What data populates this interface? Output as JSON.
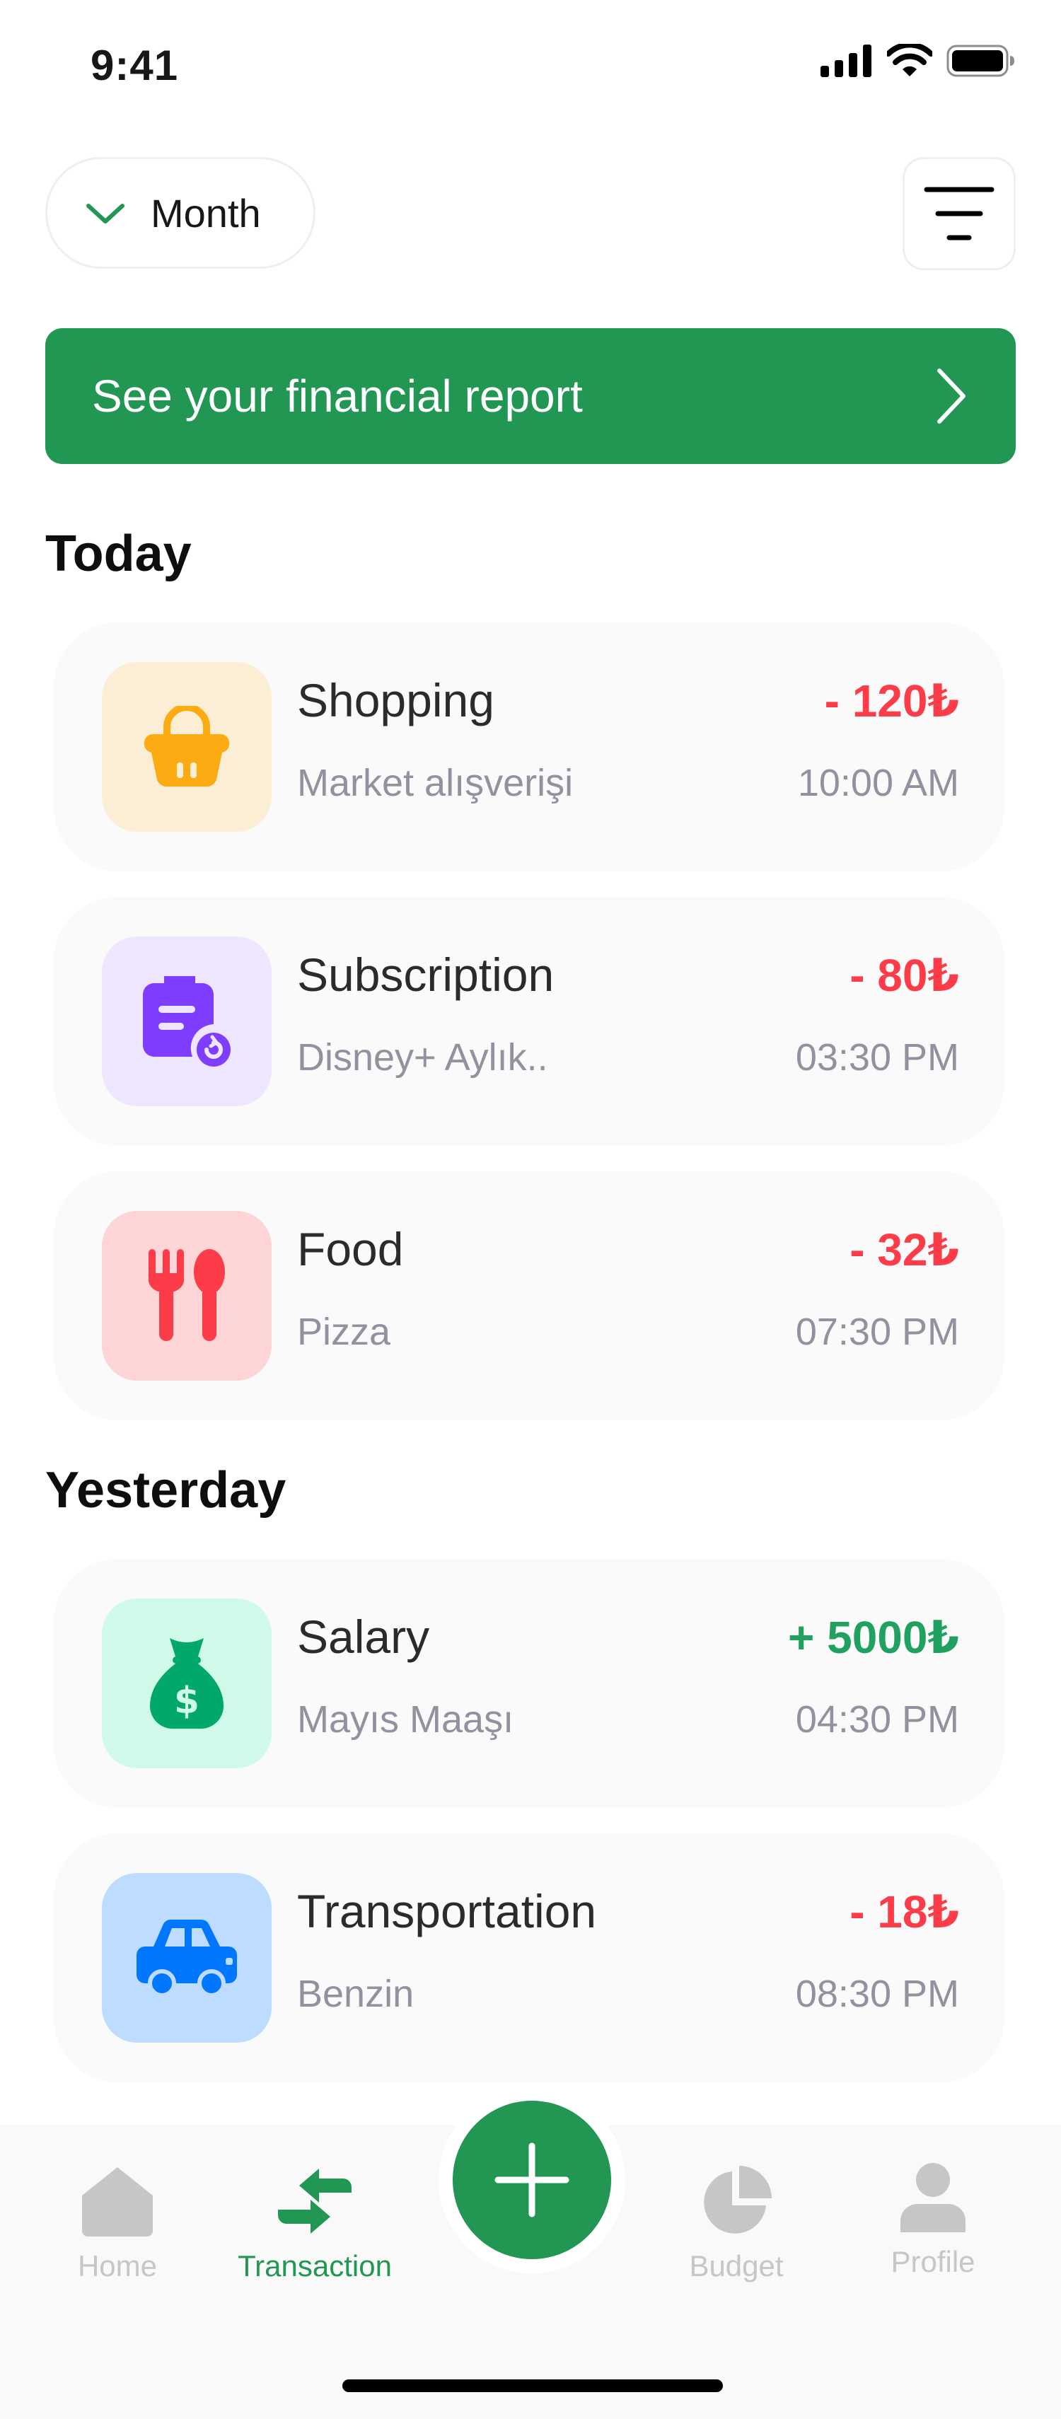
{
  "status_bar": {
    "time": "9:41",
    "icons": [
      "cellular-signal-icon",
      "wifi-icon",
      "battery-icon"
    ]
  },
  "header": {
    "period_selector": {
      "label": "Month",
      "icon": "chevron-down-icon"
    },
    "filter_button": {
      "icon": "filter-icon"
    }
  },
  "report_banner": {
    "label": "See your financial report",
    "icon": "chevron-right-icon"
  },
  "sections": [
    {
      "title": "Today",
      "transactions": [
        {
          "category": "Shopping",
          "note": "Market alışverişi",
          "amount": "- 120₺",
          "time": "10:00 AM",
          "icon": "shopping-basket-icon",
          "type": "expense"
        },
        {
          "category": "Subscription",
          "note": "Disney+ Aylık..",
          "amount": "- 80₺",
          "time": "03:30 PM",
          "icon": "subscription-icon",
          "type": "expense"
        },
        {
          "category": "Food",
          "note": "Pizza",
          "amount": "- 32₺",
          "time": "07:30 PM",
          "icon": "restaurant-icon",
          "type": "expense"
        }
      ]
    },
    {
      "title": "Yesterday",
      "transactions": [
        {
          "category": "Salary",
          "note": "Mayıs Maaşı",
          "amount": "+ 5000₺",
          "time": "04:30 PM",
          "icon": "money-bag-icon",
          "type": "income"
        },
        {
          "category": "Transportation",
          "note": "Benzin",
          "amount": "- 18₺",
          "time": "08:30 PM",
          "icon": "car-icon",
          "type": "expense"
        }
      ]
    }
  ],
  "tab_bar": {
    "items": [
      {
        "label": "Home",
        "icon": "home-icon",
        "active": false
      },
      {
        "label": "Transaction",
        "icon": "transaction-icon",
        "active": true
      },
      {
        "label": "Budget",
        "icon": "pie-chart-icon",
        "active": false
      },
      {
        "label": "Profile",
        "icon": "user-icon",
        "active": false
      }
    ],
    "fab": {
      "icon": "plus-icon"
    }
  },
  "colors": {
    "primary_green": "#229653",
    "expense_red": "#FD3C4A",
    "income_green": "#20A160",
    "muted_text": "#91919F",
    "card_bg": "#FAFAFA",
    "tab_inactive": "#C6C6C6"
  }
}
